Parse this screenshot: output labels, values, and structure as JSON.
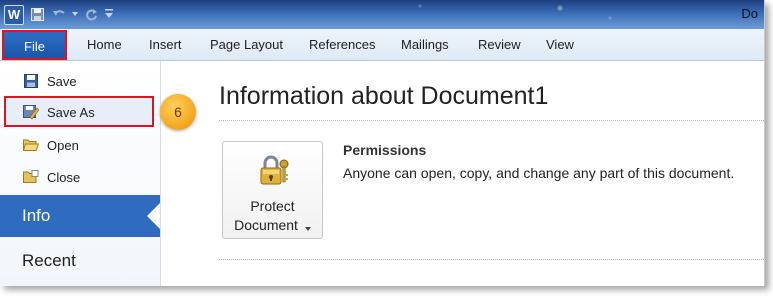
{
  "window": {
    "title_fragment": "Do",
    "app_icon_letter": "W"
  },
  "quick_access": [
    {
      "name": "save-icon"
    },
    {
      "name": "undo-icon"
    },
    {
      "name": "redo-icon"
    },
    {
      "name": "customize-icon"
    }
  ],
  "ribbon": {
    "file_tab": "File",
    "tabs": [
      "Home",
      "Insert",
      "Page Layout",
      "References",
      "Mailings",
      "Review",
      "View"
    ]
  },
  "backstage_menu": {
    "items": [
      {
        "label": "Save",
        "icon": "save-icon"
      },
      {
        "label": "Save As",
        "icon": "save-as-icon"
      },
      {
        "label": "Open",
        "icon": "open-folder-icon"
      },
      {
        "label": "Close",
        "icon": "close-folder-icon"
      }
    ],
    "info": "Info",
    "recent": "Recent"
  },
  "step_badge": "6",
  "content": {
    "title": "Information about Document1",
    "protect_button": {
      "line1": "Protect",
      "line2": "Document"
    },
    "permissions": {
      "title": "Permissions",
      "description": "Anyone can open, copy, and change any part of this document."
    }
  },
  "colors": {
    "accent_blue": "#2f6bbf",
    "highlight_red": "#e0141c",
    "badge_orange": "#f2a51a"
  }
}
